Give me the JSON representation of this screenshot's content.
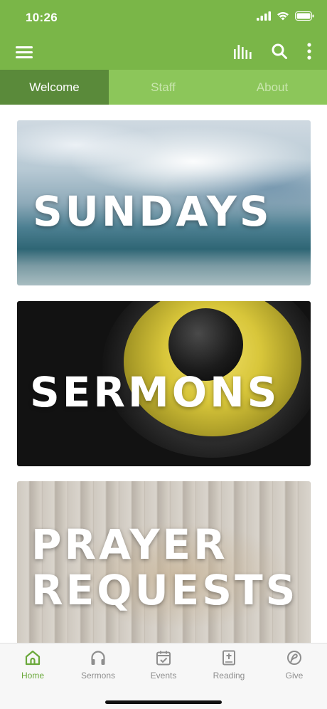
{
  "status_bar": {
    "time": "10:26"
  },
  "app_bar": {
    "icons": [
      "menu-icon",
      "stats-bars-icon",
      "search-icon",
      "more-vertical-icon"
    ],
    "color": "#7ab648"
  },
  "tabs": [
    {
      "label": "Welcome",
      "active": true
    },
    {
      "label": "Staff",
      "active": false
    },
    {
      "label": "About",
      "active": false
    }
  ],
  "cards": {
    "sundays": {
      "title": "SUNDAYS"
    },
    "sermons": {
      "title": "SERMONS"
    },
    "prayer": {
      "title_line1": "PRAYER",
      "title_line2": "REQUESTS"
    }
  },
  "bottom_nav": {
    "items": [
      {
        "label": "Home",
        "icon": "home-icon",
        "active": true
      },
      {
        "label": "Sermons",
        "icon": "headphones-icon",
        "active": false
      },
      {
        "label": "Events",
        "icon": "calendar-check-icon",
        "active": false
      },
      {
        "label": "Reading",
        "icon": "bible-icon",
        "active": false
      },
      {
        "label": "Give",
        "icon": "give-icon",
        "active": false
      }
    ],
    "active_color": "#6aa83a",
    "inactive_color": "#8e8e8e"
  }
}
